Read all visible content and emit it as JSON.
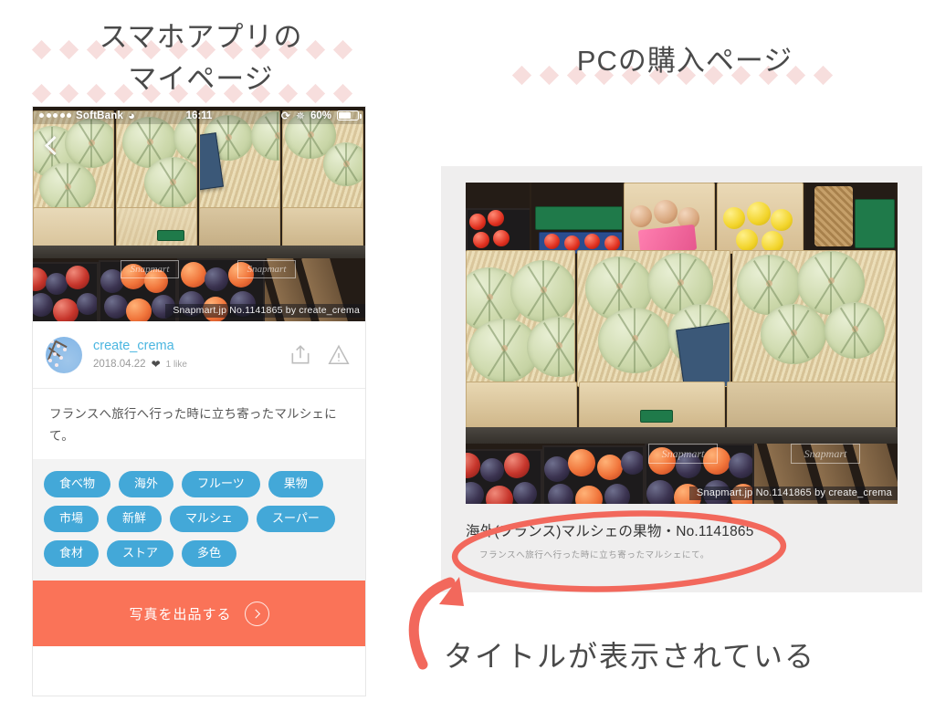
{
  "headings": {
    "phone": {
      "line1": "スマホアプリの",
      "line2": "マイページ"
    },
    "pc": {
      "line1": "PCの購入ページ"
    }
  },
  "phone": {
    "status_bar": {
      "carrier": "SoftBank",
      "time": "16:11",
      "battery_percent": "60%",
      "signal_dots": 5,
      "wifi_icon": "wifi-icon",
      "rotation_lock_icon": "rotation-lock-icon",
      "bluetooth_icon": "bluetooth-icon"
    },
    "photo": {
      "back_icon": "back-chevron-icon",
      "watermark": "Snapmart.jp No.1141865 by create_crema",
      "watermark_box_1": "Snapmart",
      "watermark_box_2": "Snapmart"
    },
    "user": {
      "name": "create_crema",
      "date": "2018.04.22",
      "heart_icon": "heart-icon",
      "likes": "1 like",
      "share_icon": "share-icon",
      "report_icon": "report-warning-icon",
      "avatar": "avatar"
    },
    "description": "フランスへ旅行へ行った時に立ち寄ったマルシェにて。",
    "tags": [
      "食べ物",
      "海外",
      "フルーツ",
      "果物",
      "市場",
      "新鮮",
      "マルシェ",
      "スーパー",
      "食材",
      "ストア",
      "多色"
    ],
    "cta": {
      "label": "写真を出品する",
      "chevron_icon": "chevron-right-icon"
    }
  },
  "pc": {
    "photo_watermark": "Snapmart.jp No.1141865 by create_crema",
    "title": "海外(フランス)マルシェの果物・No.1141865",
    "description": "フランスへ旅行へ行った時に立ち寄ったマルシェにて。"
  },
  "annotation": {
    "caption": "タイトルが表示されている",
    "highlight_color": "#f2685c",
    "ellipse_label": "title-highlight-ellipse",
    "arrow_label": "pointer-arrow"
  },
  "colors": {
    "tag_blue": "#43a8d8",
    "cta_orange": "#fa7358",
    "username_blue": "#4bb6e0",
    "diamond_pink": "#f7dedd",
    "heading_gray": "#4a4a4a",
    "pc_card_gray": "#efeeee"
  }
}
